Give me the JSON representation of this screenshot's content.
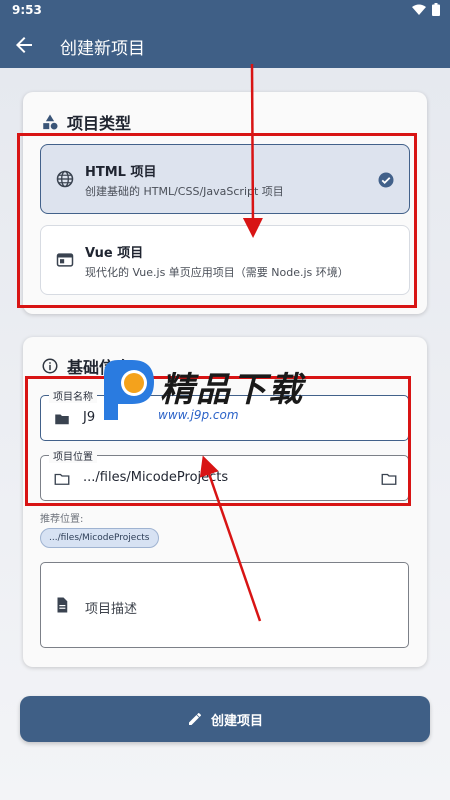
{
  "status_bar": {
    "time": "9:53"
  },
  "app_bar": {
    "title": "创建新项目",
    "back_icon": "arrow-left-icon"
  },
  "project_type": {
    "heading": "项目类型",
    "options": [
      {
        "title": "HTML 项目",
        "description": "创建基础的 HTML/CSS/JavaScript 项目",
        "icon": "globe-icon",
        "selected": true
      },
      {
        "title": "Vue 项目",
        "description": "现代化的 Vue.js 单页应用项目（需要 Node.js 环境）",
        "icon": "window-icon",
        "selected": false
      }
    ]
  },
  "basic_info": {
    "heading": "基础信息",
    "name_field": {
      "label": "项目名称",
      "value": "J9"
    },
    "location_field": {
      "label": "项目位置",
      "value": ".../files/MicodeProjects"
    },
    "suggest_label": "推荐位置:",
    "suggest_chip": ".../files/MicodeProjects",
    "description_placeholder": "项目描述"
  },
  "create_button": {
    "label": "创建项目"
  },
  "watermark": {
    "text": "精品下载",
    "url": "www.j9p.com"
  },
  "colors": {
    "primary": "#3f5f86",
    "annotation": "#d81414",
    "selected_bg": "#dde3ee"
  }
}
